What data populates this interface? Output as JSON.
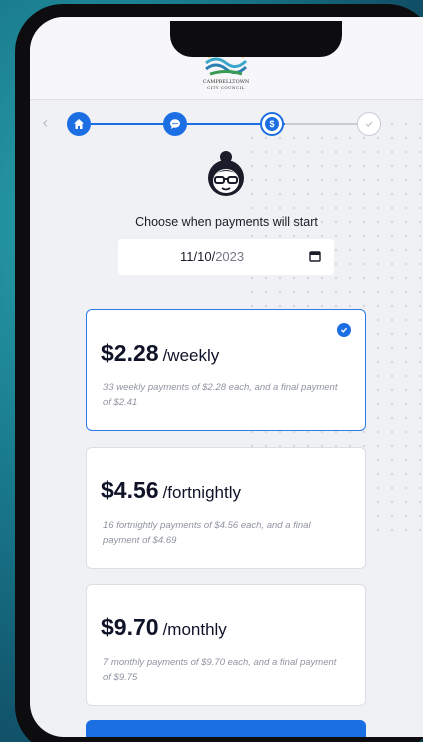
{
  "header": {
    "logo_line1": "CAMPBELLTOWN",
    "logo_line2": "CITY COUNCIL"
  },
  "stepper": {
    "steps": [
      {
        "icon": "home-icon",
        "state": "done"
      },
      {
        "icon": "chat-icon",
        "state": "done"
      },
      {
        "icon": "dollar-icon",
        "state": "current"
      },
      {
        "icon": "check-icon",
        "state": "todo"
      }
    ],
    "accent": "#1b6fe3"
  },
  "start": {
    "prompt": "Choose when payments will start",
    "date_day_month": "11/10/",
    "date_year": "2023"
  },
  "plans": [
    {
      "amount": "$2.28",
      "period": "/weekly",
      "detail": "33 weekly payments of $2.28 each, and a final payment of $2.41",
      "selected": true
    },
    {
      "amount": "$4.56",
      "period": "/fortnightly",
      "detail": "16 fortnightly payments of $4.56 each, and a final payment of $4.69",
      "selected": false
    },
    {
      "amount": "$9.70",
      "period": "/monthly",
      "detail": "7 monthly payments of $9.70 each, and a final payment of $9.75",
      "selected": false
    }
  ]
}
